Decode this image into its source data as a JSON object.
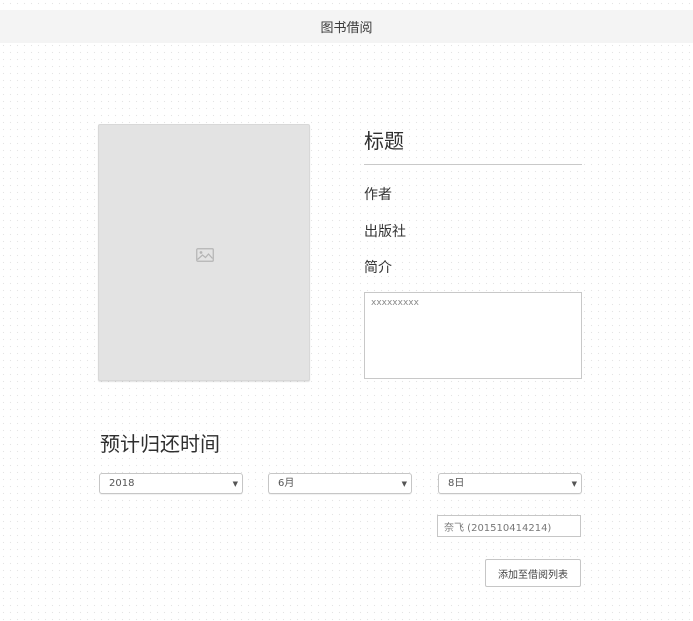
{
  "header": {
    "title": "图书借阅"
  },
  "book": {
    "cover_icon": "image-placeholder-icon",
    "title": "标题",
    "author_label": "作者",
    "publisher_label": "出版社",
    "summary_label": "简介",
    "summary_text": "xxxxxxxxx"
  },
  "return_date": {
    "section_title": "预计归还时间",
    "year": "2018",
    "month": "6月",
    "day": "8日",
    "dropdown_icon": "caret-down-icon"
  },
  "borrower": {
    "value": "奈飞 (201510414214)"
  },
  "actions": {
    "add_label": "添加至借阅列表"
  },
  "colors": {
    "header_background": "#f4f4f4",
    "cover_placeholder": "#e3e3e3",
    "border": "#c6c6c6"
  }
}
